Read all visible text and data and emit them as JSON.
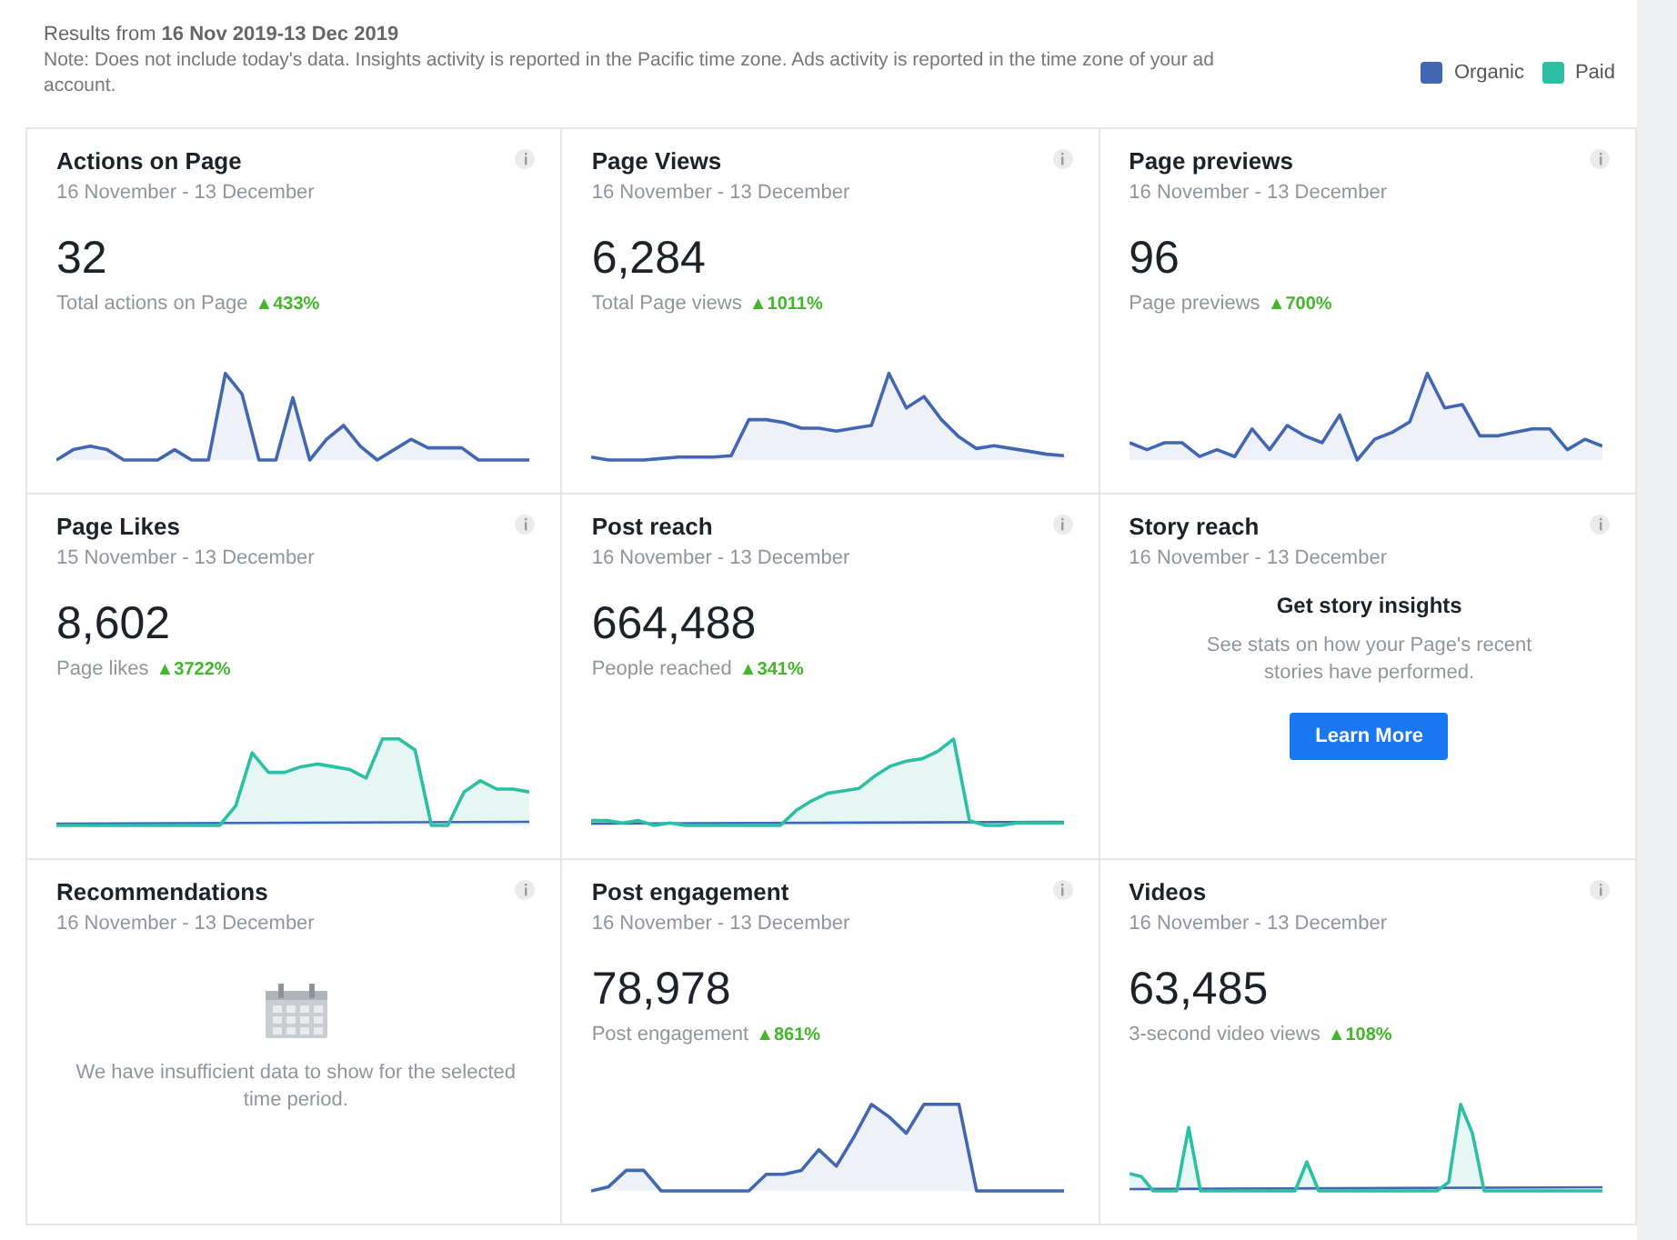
{
  "header": {
    "range_label": "Results from **16 Nov 2019-13 Dec 2019**",
    "note": "Note: Does not include today's data. Insights activity is reported in the Pacific time zone. Ads activity is reported in the time zone of your ad account."
  },
  "legend": [
    {
      "label": "Organic",
      "color": "#4267b2"
    },
    {
      "label": "Paid",
      "color": "#2bbfa4"
    }
  ],
  "cards": [
    {
      "kind": "metric",
      "title": "Actions on Page",
      "dates": "16 November - 13 December",
      "value": "32",
      "caption": "Total actions on Page",
      "change": "▲433%"
    },
    {
      "kind": "metric",
      "title": "Page Views",
      "dates": "16 November - 13 December",
      "value": "6,284",
      "caption": "Total Page views",
      "change": "▲1011%"
    },
    {
      "kind": "metric",
      "title": "Page previews",
      "dates": "16 November - 13 December",
      "value": "96",
      "caption": "Page previews",
      "change": "▲700%"
    },
    {
      "kind": "metric",
      "title": "Page Likes",
      "dates": "15 November - 13 December",
      "value": "8,602",
      "caption": "Page likes",
      "change": "▲3722%"
    },
    {
      "kind": "metric",
      "title": "Post reach",
      "dates": "16 November - 13 December",
      "value": "664,488",
      "caption": "People reached",
      "change": "▲341%"
    },
    {
      "kind": "promo",
      "title": "Story reach",
      "dates": "16 November - 13 December",
      "heading": "Get story insights",
      "body": "See stats on how your Page's recent stories have performed.",
      "button": "Learn More"
    },
    {
      "kind": "empty",
      "title": "Recommendations",
      "dates": "16 November - 13 December",
      "message": "We have insufficient data to show for the selected time period."
    },
    {
      "kind": "metric",
      "title": "Post engagement",
      "dates": "16 November - 13 December",
      "value": "78,978",
      "caption": "Post engagement",
      "change": "▲861%"
    },
    {
      "kind": "metric",
      "title": "Videos",
      "dates": "16 November - 13 December",
      "value": "63,485",
      "caption": "3-second video views",
      "change": "▲108%"
    }
  ]
}
